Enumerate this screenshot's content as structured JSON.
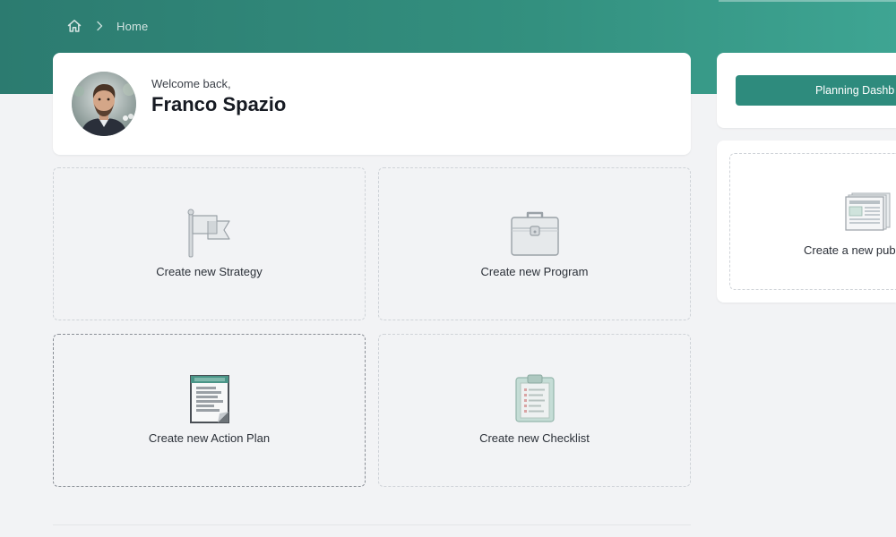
{
  "breadcrumb": {
    "home_icon": "home-icon",
    "separator_icon": "chevron-right-icon",
    "current": "Home"
  },
  "welcome": {
    "label": "Welcome back,",
    "name": "Franco Spazio"
  },
  "tiles": [
    {
      "label": "Create new Strategy",
      "icon": "flag-icon"
    },
    {
      "label": "Create new Program",
      "icon": "briefcase-icon"
    },
    {
      "label": "Create new Action Plan",
      "icon": "document-icon"
    },
    {
      "label": "Create new Checklist",
      "icon": "clipboard-icon"
    }
  ],
  "sidebar": {
    "planning_button": "Planning Dashb",
    "publication_label": "Create a new pub",
    "publication_icon": "newspaper-icon"
  },
  "colors": {
    "header": "#2c7b70",
    "accent": "#2e8b7d",
    "background": "#f2f3f5"
  }
}
